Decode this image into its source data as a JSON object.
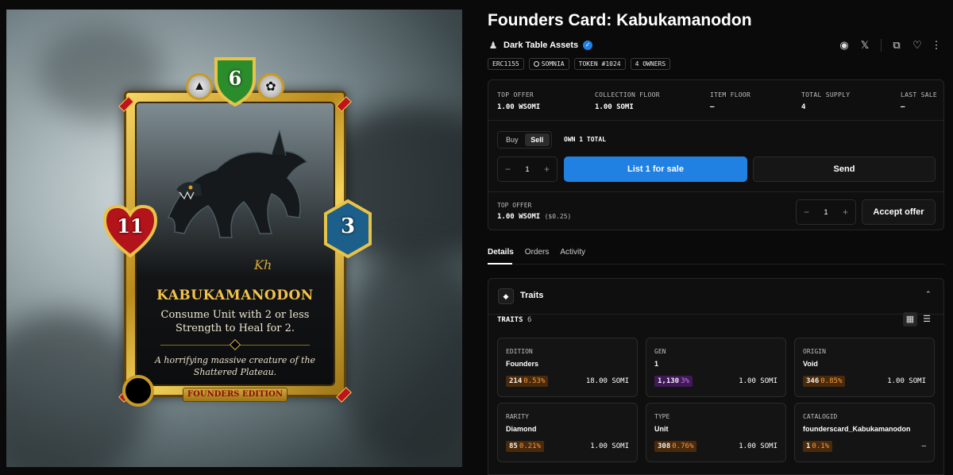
{
  "page_title": "Founders Card: Kabukamanodon",
  "card_art": {
    "mana": "6",
    "health": "11",
    "attack": "3",
    "name": "KABUKAMANODON",
    "ability": "Consume Unit with 2 or less Strength to Heal for 2.",
    "flavor": "A horrifying massive creature of the Shattered Plateau.",
    "edition": "FOUNDERS EDITION"
  },
  "creator": {
    "name": "Dark Table Assets"
  },
  "chips": [
    "ERC1155",
    "SOMNIA",
    "TOKEN #1024",
    "4 OWNERS"
  ],
  "stats": [
    {
      "label": "TOP OFFER",
      "value": "1.00 WSOMI"
    },
    {
      "label": "COLLECTION FLOOR",
      "value": "1.00 SOMI"
    },
    {
      "label": "ITEM FLOOR",
      "value": "–"
    },
    {
      "label": "TOTAL SUPPLY",
      "value": "4"
    },
    {
      "label": "LAST SALE",
      "value": "–"
    }
  ],
  "trade": {
    "buy_label": "Buy",
    "sell_label": "Sell",
    "active_mode": "Sell",
    "own_total": "OWN 1 TOTAL",
    "quantity": "1",
    "list_label": "List 1 for sale",
    "send_label": "Send",
    "top_offer_label": "TOP OFFER",
    "top_offer_value": "1.00 WSOMI",
    "top_offer_usd": "($0.25)",
    "offer_quantity": "1",
    "accept_label": "Accept offer"
  },
  "tabs": [
    "Details",
    "Orders",
    "Activity"
  ],
  "traits": {
    "header": "Traits",
    "count_label": "TRAITS",
    "count": "6",
    "items": [
      {
        "type": "EDITION",
        "value": "Founders",
        "count": "214",
        "pct": "0.53%",
        "price": "18.00 SOMI",
        "color": "#f59b3f"
      },
      {
        "type": "GEN",
        "value": "1",
        "count": "1,130",
        "pct": "3%",
        "price": "1.00 SOMI",
        "color": "#c77af0"
      },
      {
        "type": "ORIGIN",
        "value": "Void",
        "count": "346",
        "pct": "0.85%",
        "price": "1.00 SOMI",
        "color": "#f59b3f"
      },
      {
        "type": "RARITY",
        "value": "Diamond",
        "count": "85",
        "pct": "0.21%",
        "price": "1.00 SOMI",
        "color": "#f59b3f"
      },
      {
        "type": "TYPE",
        "value": "Unit",
        "count": "308",
        "pct": "0.76%",
        "price": "1.00 SOMI",
        "color": "#f59b3f"
      },
      {
        "type": "CATALOGID",
        "value": "founderscard_Kabukamanodon",
        "count": "1",
        "pct": "0.1%",
        "price": "–",
        "color": "#f59b3f"
      }
    ]
  },
  "colors": {
    "accent": "#2081e2",
    "background": "#0a0a0a",
    "panel": "#0f0f0f"
  }
}
